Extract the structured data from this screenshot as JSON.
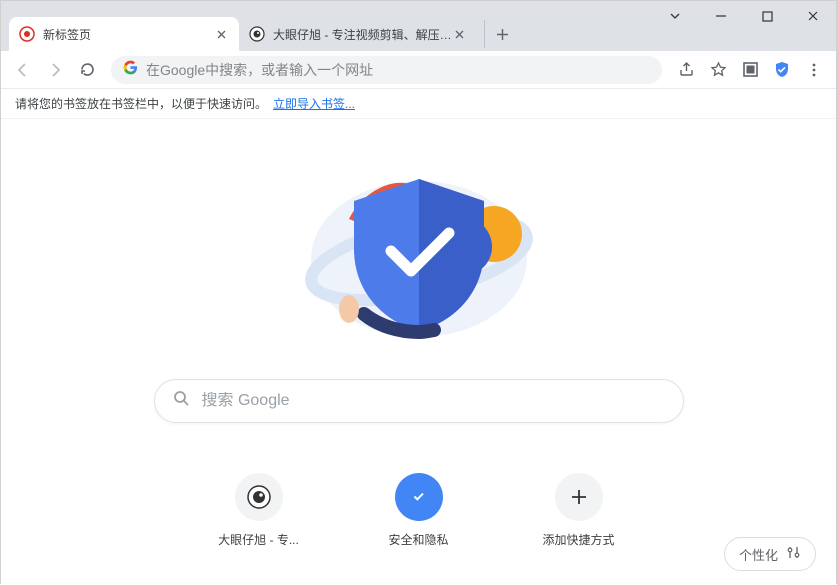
{
  "tabs": [
    {
      "title": "新标签页",
      "active": true
    },
    {
      "title": "大眼仔旭 - 专注视频剪辑、解压…",
      "active": false
    }
  ],
  "omnibox": {
    "placeholder": "在Google中搜索，或者输入一个网址"
  },
  "bookmark_hint": {
    "text": "请将您的书签放在书签栏中，以便于快速访问。",
    "link": "立即导入书签..."
  },
  "search": {
    "placeholder": "搜索 Google"
  },
  "shortcuts": [
    {
      "label": "大眼仔旭 - 专..."
    },
    {
      "label": "安全和隐私"
    },
    {
      "label": "添加快捷方式"
    }
  ],
  "customize": {
    "label": "个性化"
  }
}
